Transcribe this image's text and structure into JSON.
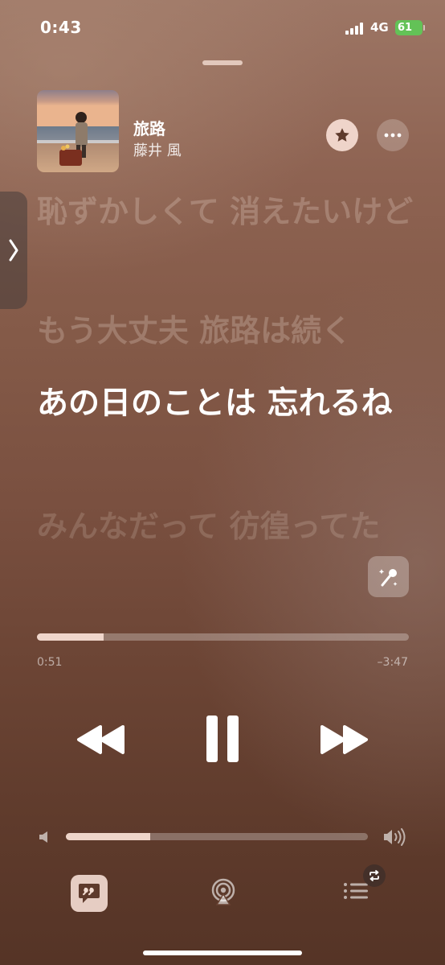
{
  "status": {
    "time": "0:43",
    "network": "4G",
    "battery": "61"
  },
  "now_playing": {
    "title": "旅路",
    "artist": "藤井 風"
  },
  "lyrics": {
    "line1": "恥ずかしくて 消えたいけど",
    "line2": "もう大丈夫 旅路は続く",
    "line3": "あの日のことは 忘れるね",
    "line4": "みんなだって 彷徨ってた"
  },
  "playback": {
    "elapsed": "0:51",
    "remaining": "–3:47",
    "progress": 0.18
  },
  "volume": {
    "level": 0.28
  },
  "icons": {
    "favorite": "star-icon",
    "more": "ellipsis-icon",
    "side_tab": "chevron-right-icon",
    "karaoke": "microphone-sparkles-icon",
    "rewind": "rewind-icon",
    "pause": "pause-icon",
    "forward": "fast-forward-icon",
    "volume_low": "speaker-low-icon",
    "volume_high": "speaker-high-icon",
    "lyrics": "quote-bubble-icon",
    "airplay": "airplay-icon",
    "queue": "list-icon",
    "repeat": "repeat-icon"
  },
  "colors": {
    "battery": "#63c257",
    "background_top": "#9d7665",
    "background_bottom": "#553426"
  }
}
